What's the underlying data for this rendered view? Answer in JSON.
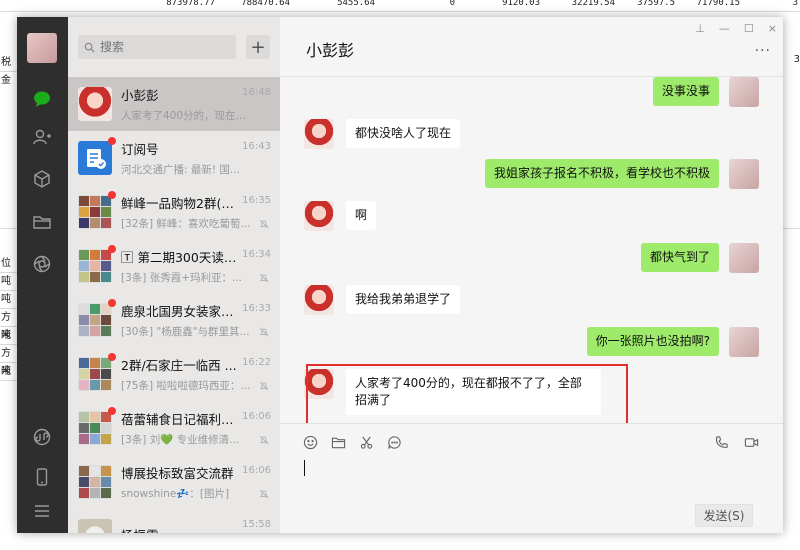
{
  "sheet": {
    "top_numbers": [
      "873978.77",
      "788470.64",
      "5455.64",
      "0",
      "9120.03",
      "32219.54",
      "37597.5",
      "71790.15",
      "3"
    ],
    "left_text": [
      "税金"
    ],
    "left_col": [
      "位",
      "吨",
      "吨",
      "方米",
      "吨",
      "方米",
      "吨"
    ],
    "right_text": [
      "3"
    ]
  },
  "search": {
    "placeholder": "搜索",
    "add_label": "+"
  },
  "window_controls": [
    "⊥",
    "—",
    "☐",
    "×"
  ],
  "chats": [
    {
      "name": "小彭彭",
      "preview": "人家考了400分的，现在都报不了...",
      "time": "16:48",
      "active": true,
      "badge": false,
      "muted": false
    },
    {
      "name": "订阅号",
      "preview": "河北交通广播: 最新! 国...",
      "time": "16:43",
      "active": false,
      "badge": true,
      "muted": false
    },
    {
      "name": "鲜峰一品购物2群(禁...",
      "preview": "[32条] 鲜峰：喜欢吃葡萄...",
      "time": "16:35",
      "active": false,
      "badge": true,
      "muted": true
    },
    {
      "name": "🅃 第二期300天读 ...",
      "preview": "[3条] 张秀霞+玛利亚：...",
      "time": "16:34",
      "active": false,
      "badge": true,
      "muted": true
    },
    {
      "name": "鹿泉北国男女装家居...",
      "preview": "[30条] \"杨鹿鑫\"与群里其...",
      "time": "16:33",
      "active": false,
      "badge": true,
      "muted": true
    },
    {
      "name": "2群/石家庄一临西 ...",
      "preview": "[75条] 啦啦啦德玛西亚：...",
      "time": "16:22",
      "active": false,
      "badge": true,
      "muted": true
    },
    {
      "name": "蓓蕾辅食日记福利群...",
      "preview": "[3条] 刘💚 专业维修清...",
      "time": "16:06",
      "active": false,
      "badge": true,
      "muted": true
    },
    {
      "name": "博展投标致富交流群",
      "preview": "snowshine💤：[图片]",
      "time": "16:06",
      "active": false,
      "badge": false,
      "muted": true
    },
    {
      "name": "杨振雷",
      "preview": "",
      "time": "15:58",
      "active": false,
      "badge": false,
      "muted": false
    }
  ],
  "conversation": {
    "title": "小彭彭",
    "more": "···",
    "messages": [
      {
        "side": "right",
        "text": "没事没事"
      },
      {
        "side": "left",
        "text": "都快没啥人了现在"
      },
      {
        "side": "right",
        "text": "我姐家孩子报名不积极，看学校也不积极"
      },
      {
        "side": "left",
        "text": "啊"
      },
      {
        "side": "right",
        "text": "都快气到了"
      },
      {
        "side": "left",
        "text": "我给我弟弟退学了"
      },
      {
        "side": "right",
        "text": "你一张照片也没拍啊?"
      },
      {
        "side": "left",
        "text": "人家考了400分的，现在都报不了了，全部招满了"
      }
    ]
  },
  "input": {
    "send_label": "发送(S)"
  },
  "colors": {
    "nav_bg": "#2e2e2e",
    "list_bg": "#e9e8e7",
    "bubble_mine": "#9eea6a",
    "bubble_theirs": "#ffffff",
    "nav_active": "#1aad19",
    "annotation": "#e0302a"
  }
}
